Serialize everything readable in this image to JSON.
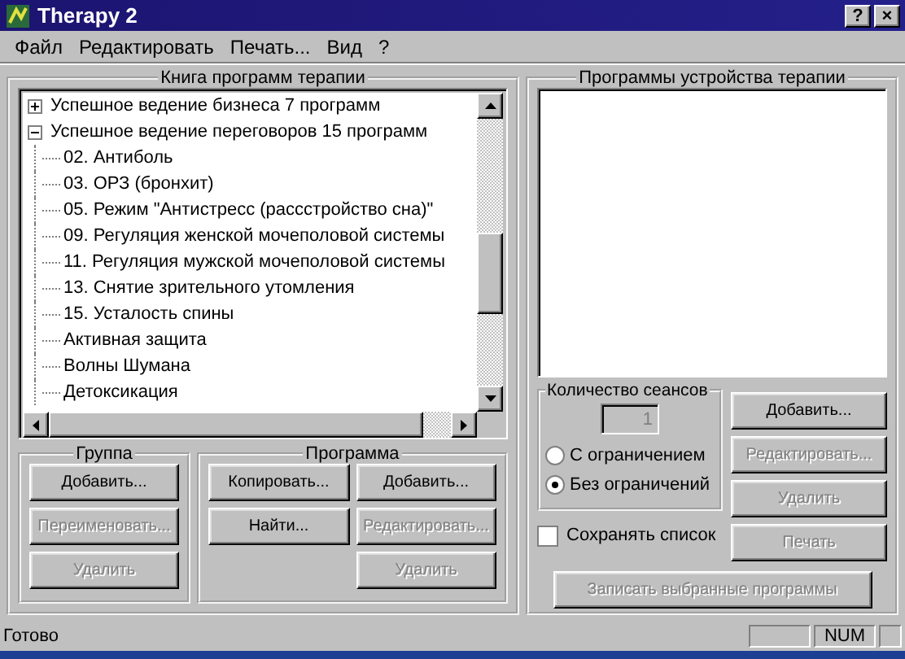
{
  "window": {
    "title": "Therapy 2",
    "buttons": [
      "?",
      "×"
    ]
  },
  "menu": [
    "Файл",
    "Редактировать",
    "Печать...",
    "Вид",
    "?"
  ],
  "library": {
    "title": "Книга программ терапии",
    "tree": [
      {
        "label": "Успешное ведение бизнеса 7 программ",
        "expanded": false
      },
      {
        "label": "Успешное ведение переговоров 15 программ",
        "expanded": true,
        "children": [
          {
            "label": "02. Антиболь"
          },
          {
            "label": "03. ОРЗ (бронхит)"
          },
          {
            "label": "05. Режим \"Антистресс (рассстройство сна)\""
          },
          {
            "label": "09. Регуляция женской мочеполовой системы"
          },
          {
            "label": "11. Регуляция мужской мочеполовой системы"
          },
          {
            "label": "13. Снятие зрительного утомления"
          },
          {
            "label": "15. Усталость спины"
          },
          {
            "label": "Активная защита"
          },
          {
            "label": "Волны Шумана"
          },
          {
            "label": "Детоксикация"
          }
        ]
      }
    ]
  },
  "group": {
    "title": "Группа",
    "buttons": [
      {
        "label": "Добавить...",
        "disabled": false
      },
      {
        "label": "Переименовать...",
        "disabled": true
      },
      {
        "label": "Удалить",
        "disabled": true
      }
    ]
  },
  "program": {
    "title": "Программа",
    "buttons": [
      {
        "label": "Копировать...",
        "disabled": false
      },
      {
        "label": "Добавить...",
        "disabled": false
      },
      {
        "label": "Найти...",
        "disabled": false
      },
      {
        "label": "Редактировать...",
        "disabled": true
      },
      {
        "label": "Удалить",
        "disabled": true
      }
    ]
  },
  "device": {
    "title": "Программы устройства терапии"
  },
  "sessions": {
    "title": "Количество сеансов",
    "count": "1",
    "count_disabled": true,
    "options": [
      {
        "label": "С ограничением",
        "selected": false
      },
      {
        "label": "Без ограничений",
        "selected": true
      }
    ]
  },
  "device_buttons": [
    {
      "label": "Добавить...",
      "disabled": false
    },
    {
      "label": "Редактировать...",
      "disabled": true
    },
    {
      "label": "Удалить",
      "disabled": true
    },
    {
      "label": "Печать",
      "disabled": true
    }
  ],
  "save_list": {
    "label": "Сохранять список",
    "checked": false
  },
  "write_button": {
    "label": "Записать выбранные программы",
    "disabled": true
  },
  "status_bar": {
    "text": "Готово",
    "indicator": "NUM"
  }
}
